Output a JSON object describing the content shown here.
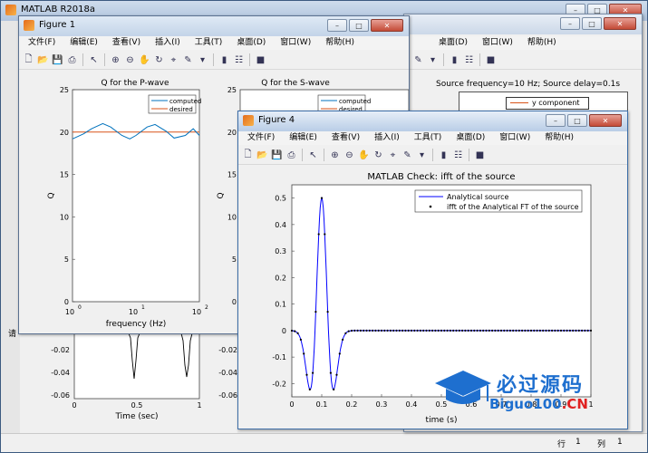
{
  "main_window": {
    "title": "MATLAB R2018a",
    "status_row_label": "行",
    "status_row": "1",
    "status_col_label": "列",
    "status_col": "1",
    "left_stub": "请"
  },
  "menus": [
    "文件(F)",
    "编辑(E)",
    "查看(V)",
    "插入(I)",
    "工具(T)",
    "桌面(D)",
    "窗口(W)",
    "帮助(H)"
  ],
  "back_window": {
    "menus": [
      "桌面(D)",
      "窗口(W)",
      "帮助(H)"
    ],
    "title_text": "Source frequency=10 Hz; Source delay=0.1s",
    "legend": "y component"
  },
  "figure1": {
    "title": "Figure 1",
    "p_wave": {
      "title": "Q for the P-wave",
      "xlabel": "frequency (Hz)",
      "ylabel": "Q",
      "legend": [
        "computed",
        "desired"
      ],
      "yticks": [
        "0",
        "5",
        "10",
        "15",
        "20",
        "25"
      ],
      "xticks": [
        "10",
        "10",
        "10"
      ],
      "xtick_exp": [
        "0",
        "1",
        "2"
      ]
    },
    "s_wave": {
      "title": "Q for the S-wave",
      "ylabel": "Q",
      "legend": [
        "computed",
        "desired"
      ],
      "yticks": [
        "0",
        "5",
        "10",
        "15",
        "20",
        "25"
      ]
    }
  },
  "lower_plots": {
    "left": {
      "xlabel": "Time (sec)",
      "yticks": [
        "-0.02",
        "-0.04",
        "-0.06"
      ],
      "xticks": [
        "0",
        "0.5",
        "1"
      ]
    },
    "right_yticks": [
      "-0.02",
      "-0.04",
      "-0.06"
    ]
  },
  "figure4": {
    "title": "Figure 4",
    "plot_title": "MATLAB Check: ifft of the source",
    "xlabel": "time (s)",
    "legend": [
      "Analytical source",
      "ifft of the Analytical FT of the source"
    ],
    "yticks": [
      "0.5",
      "0.4",
      "0.3",
      "0.2",
      "0.1",
      "0",
      "-0.1",
      "-0.2"
    ],
    "xticks": [
      "0",
      "0.1",
      "0.2",
      "0.3",
      "0.4",
      "0.5",
      "0.6",
      "0.7",
      "0.8",
      "0.9",
      "1"
    ]
  },
  "watermark": {
    "cn": "必过源码",
    "url_a": "Biguo100",
    "url_b": ".CN"
  },
  "chart_data": [
    {
      "type": "line",
      "title": "Q for the P-wave",
      "xlabel": "frequency (Hz)",
      "ylabel": "Q",
      "xscale": "log",
      "xlim": [
        1,
        100
      ],
      "ylim": [
        0,
        25
      ],
      "series": [
        {
          "name": "computed",
          "x": [
            1,
            1.5,
            2,
            3,
            4,
            6,
            8,
            10,
            15,
            20,
            30,
            40,
            60,
            80,
            100
          ],
          "values": [
            19.2,
            19.8,
            20.4,
            21.0,
            20.6,
            19.6,
            19.2,
            19.6,
            20.6,
            20.9,
            20.1,
            19.3,
            19.6,
            20.4,
            19.6
          ]
        },
        {
          "name": "desired",
          "x": [
            1,
            100
          ],
          "values": [
            20,
            20
          ]
        }
      ],
      "colors": {
        "computed": "#0072bd",
        "desired": "#d95319"
      }
    },
    {
      "type": "line",
      "title": "MATLAB Check: ifft of the source",
      "xlabel": "time (s)",
      "xlim": [
        0,
        1
      ],
      "ylim": [
        -0.25,
        0.55
      ],
      "series": [
        {
          "name": "Analytical source",
          "style": "line",
          "color": "#0000ff"
        },
        {
          "name": "ifft of the Analytical FT of the source",
          "style": "dots",
          "color": "#000000"
        }
      ],
      "x": [
        0,
        0.02,
        0.04,
        0.06,
        0.07,
        0.08,
        0.09,
        0.1,
        0.11,
        0.12,
        0.13,
        0.14,
        0.16,
        0.18,
        0.2,
        0.3,
        0.4,
        0.5,
        0.6,
        0.7,
        0.8,
        0.9,
        1.0
      ],
      "values": [
        0,
        -0.01,
        -0.13,
        -0.22,
        -0.11,
        0.12,
        0.4,
        0.5,
        0.4,
        0.12,
        -0.11,
        -0.22,
        -0.13,
        -0.01,
        0,
        0,
        0,
        0,
        0,
        0,
        0,
        0,
        0
      ]
    }
  ]
}
